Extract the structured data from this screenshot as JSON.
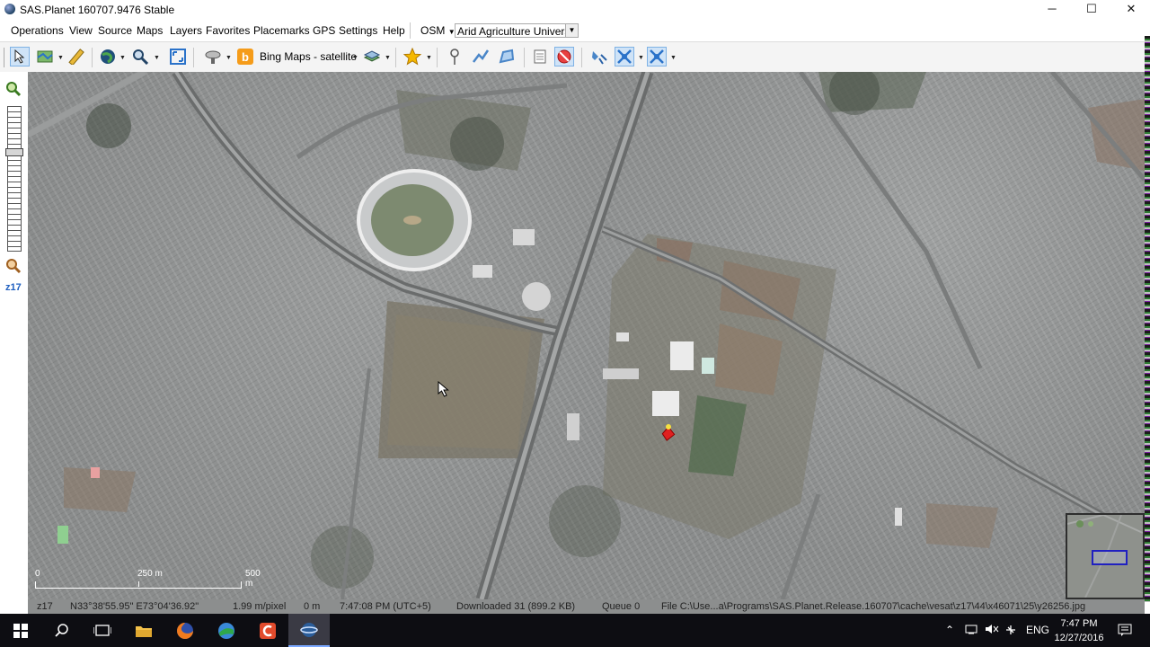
{
  "window": {
    "title": "SAS.Planet 160707.9476 Stable",
    "minimize": "─",
    "maximize": "☐",
    "close": "✕"
  },
  "menu": {
    "items": [
      "Operations",
      "View",
      "Source",
      "Maps",
      "Layers",
      "Favorites",
      "Placemarks",
      "GPS",
      "Settings",
      "Help"
    ],
    "osm_label": "OSM",
    "search_value": "Arid Agriculture Universi"
  },
  "toolbar": {
    "map_source_label": "Bing Maps - satellite"
  },
  "zoom": {
    "level_label": "z17"
  },
  "map": {
    "scale_zero": "0",
    "scale_mid": "250 m",
    "scale_end": "500 m"
  },
  "status": {
    "zoom": "z17",
    "coords": "N33°38'55.95\" E73°04'36.92\"",
    "resolution": "1.99 m/pixel",
    "distance": "0 m",
    "time": "7:47:08 PM (UTC+5)",
    "downloaded": "Downloaded 31 (899.2 KB)",
    "queue": "Queue 0",
    "file": "File C:\\Use...a\\Programs\\SAS.Planet.Release.160707\\cache\\vesat\\z17\\44\\x46071\\25\\y26256.jpg"
  },
  "taskbar": {
    "language": "ENG",
    "clock_time": "7:47 PM",
    "clock_date": "12/27/2016"
  },
  "colors": {
    "accent": "#2060c0",
    "taskbar": "#0d0d12",
    "placemark": "#e02020"
  }
}
